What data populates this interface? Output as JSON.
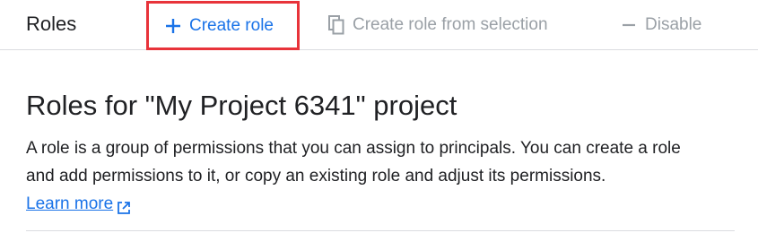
{
  "toolbar": {
    "title": "Roles",
    "create_role_label": "Create role",
    "create_from_selection_label": "Create role from selection",
    "disable_label": "Disable"
  },
  "main": {
    "heading": "Roles for \"My Project 6341\" project",
    "description": "A role is a group of permissions that you can assign to principals. You can create a role and add permissions to it, or copy an existing role and adjust its permissions.",
    "learn_more_label": "Learn more"
  },
  "icons": {
    "create": "plus-icon",
    "create_from_selection": "copy-icon",
    "disable": "minus-icon",
    "learn_more": "external-link-icon"
  },
  "colors": {
    "accent": "#1a73e8",
    "disabled": "#9aa0a6",
    "highlight_border": "#e8333a",
    "text": "#202124",
    "divider": "#dadce0"
  }
}
